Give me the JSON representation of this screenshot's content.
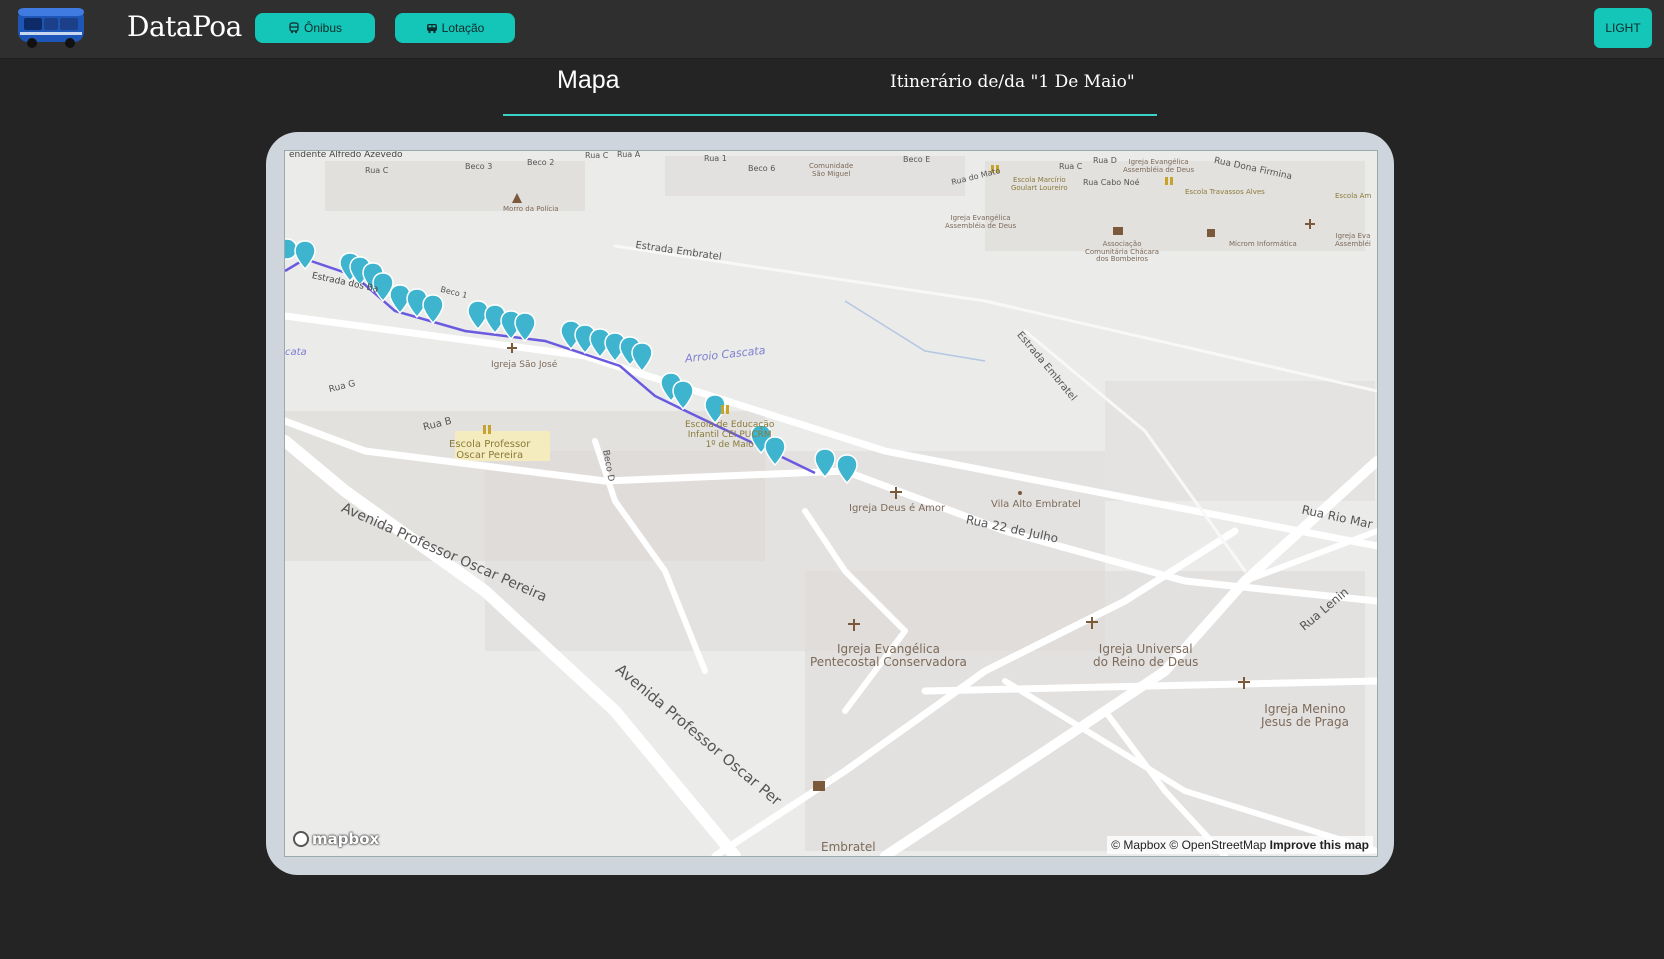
{
  "header": {
    "brand": "DataPoa",
    "nav": {
      "onibus_label": "Ônibus",
      "lotacao_label": "Lotação"
    },
    "theme_toggle_label": "LIGHT"
  },
  "tabs": {
    "mapa_label": "Mapa",
    "itinerario_label": "Itinerário de/da \"1 De Maio\""
  },
  "map": {
    "attribution": {
      "mapbox": "© Mapbox",
      "osm": "© OpenStreetMap",
      "improve": "Improve this map"
    },
    "logo_text": "mapbox",
    "labels": {
      "l01": "endente Alfredo Azevedo",
      "l02": "Rua C",
      "l03": "Beco 3",
      "l04": "Beco 2",
      "l05": "Rua C",
      "l06": "Rua A",
      "l07": "Rua 1",
      "l08": "Beco 6",
      "l09": "Comunidade\nSão Miguel",
      "l10": "Beco E",
      "l11": "Rua do Mato",
      "l12": "Escola Marcírio\nGoulart Loureiro",
      "l13": "Rua C",
      "l14": "Rua D",
      "l15": "Igreja Evangélica\nAssembléia de Deus",
      "l16": "Rua Dona Firmina",
      "l17": "Rua Cabo Noé",
      "l18": "Escola Travassos Alves",
      "l19": "Escola Am",
      "l20": "Morro da Polícia",
      "l21": "Igreja Evangélica\nAssembléia de Deus",
      "l22": "Estrada Embratel",
      "l23": "Associação\nComunitária Chácara\ndos Bombeiros",
      "l24": "Microm Informática",
      "l25": "Igreja Eva\nAssembléi",
      "l26": "Estrada dos Ba",
      "l27": "Beco 1",
      "l28": "cata",
      "l29": "Igreja São José",
      "l30": "Arroio Cascata",
      "l31": "Estrada Embratel",
      "l32": "Rua G",
      "l33": "Rua B",
      "l34": "Escola Professor\nOscar Pereira",
      "l35": "Escola de Educação\nInfantil CEI PUCRM\n1º de Maio",
      "l36": "Beco D",
      "l37": "Avenida Professor Oscar Pereira",
      "l38": "Igreja Deus é Amor",
      "l39": "Vila Alto Embratel",
      "l40": "Rua 22 de Julho",
      "l41": "Rua Rio Mar",
      "l42": "Rua Lenin",
      "l43": "Igreja Evangélica\nPentecostal Conservadora",
      "l44": "Igreja Universal\ndo Reino de Deus",
      "l45": "Igreja Menino\nJesus de Praga",
      "l46": "Avenida Professor Oscar Per",
      "l47": "Embratel"
    },
    "route_color": "#6a5ae0",
    "marker_color": "#3fb4cf"
  }
}
